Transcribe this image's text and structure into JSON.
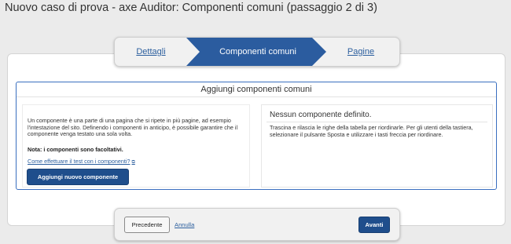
{
  "header": {
    "title": "Nuovo caso di prova - axe Auditor: Componenti comuni (passaggio 2 di 3)"
  },
  "stepper": {
    "steps": [
      {
        "label": "Dettagli",
        "state": "link"
      },
      {
        "label": "Componenti comuni",
        "state": "active"
      },
      {
        "label": "Pagine",
        "state": "link"
      }
    ],
    "active_color": "#2b5c9f"
  },
  "panel": {
    "title": "Aggiungi componenti comuni",
    "left": {
      "description": "Un componente è una parte di una pagina che si ripete in più pagine, ad esempio l'intestazione del sito. Definendo i componenti in anticipo, è possibile garantire che il componente venga testato una sola volta.",
      "note": "Nota: i componenti sono facoltativi.",
      "help_link": "Come effettuare il test con i componenti?",
      "help_icon": "external-link-icon",
      "add_button": "Aggiungi nuovo componente"
    },
    "right": {
      "heading": "Nessun componente definito.",
      "description": "Trascina e rilascia le righe della tabella per riordinarle. Per gli utenti della tastiera, selezionare il pulsante Sposta e utilizzare i tasti freccia per riordinare."
    }
  },
  "footer": {
    "previous": "Precedente",
    "cancel": "Annulla",
    "next": "Avanti"
  },
  "colors": {
    "primary": "#1f4e8c",
    "link": "#2c5f9e",
    "panel_border": "#3a6fbf"
  }
}
